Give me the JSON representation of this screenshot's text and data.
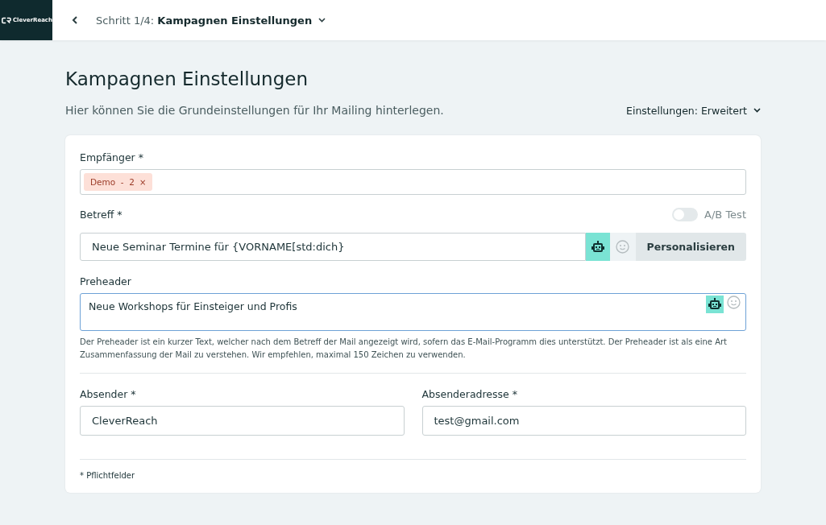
{
  "header": {
    "logo": "CleverReach",
    "step": "Schritt 1/4: **Kampagnen Einstellungen**"
  },
  "page": {
    "title": "Kampagnen Einstellungen",
    "subtitle": "Hier können Sie die Grundeinstellungen für Ihr Mailing hinterlegen.",
    "settings_menu": "Einstellungen: Erweitert"
  },
  "form": {
    "recipients": {
      "label": "Empfänger *",
      "tags": [
        {
          "label": "Demo  -  2",
          "remove": "×"
        }
      ]
    },
    "subject": {
      "label": "Betreff *",
      "value": "Neue Seminar Termine für {VORNAME[std:dich}",
      "ab_test": {
        "label": "A/B Test",
        "on": false
      },
      "personalize_button": "Personalisieren"
    },
    "preheader": {
      "label": "Preheader",
      "value": "Neue Workshops für Einsteiger und Profis",
      "focused": true,
      "help": "Der Preheader ist ein kurzer Text, welcher nach dem Betreff der Mail angezeigt wird, sofern das E-Mail-Programm dies unterstützt. Der Preheader ist als eine Art Zusammenfassung der Mail zu verstehen. Wir empfehlen, maximal 150 Zeichen zu verwenden."
    },
    "sender": {
      "label": "Absender *",
      "value": "CleverReach"
    },
    "sender_address": {
      "label": "Absenderadresse *",
      "value": "test@gmail.com"
    },
    "footnote": "* Pflichtfelder"
  }
}
